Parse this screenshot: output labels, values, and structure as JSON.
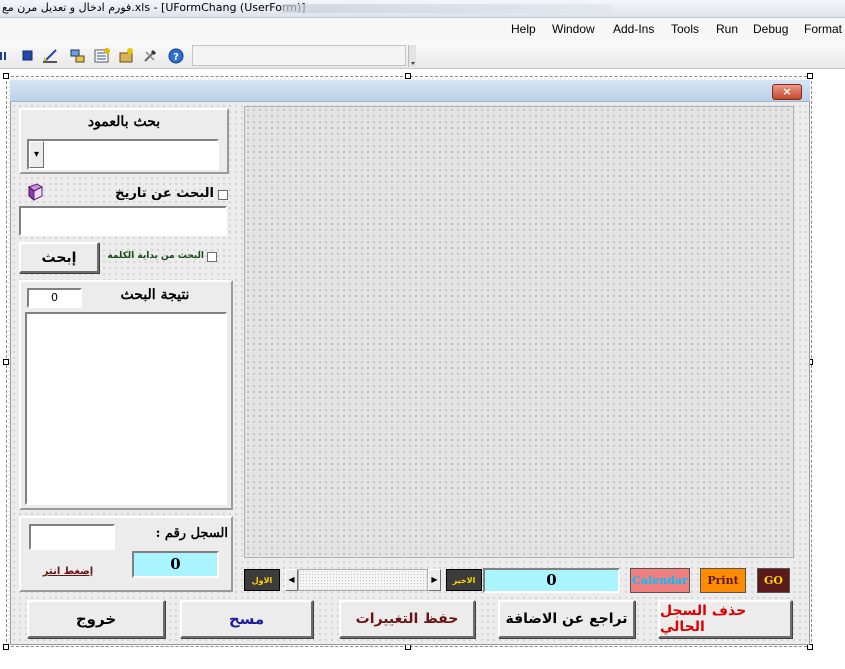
{
  "window": {
    "title": "فورم ادخال و تعديل مرن مع.xls - [UFormChang (UserForm)]"
  },
  "menu": [
    "Help",
    "Window",
    "Add-Ins",
    "Tools",
    "Run",
    "Debug",
    "Format"
  ],
  "form": {
    "close_glyph": "×",
    "column_search": {
      "label": "بحث بالعمود",
      "dropdown_glyph": "▾",
      "value": ""
    },
    "date_search": {
      "label": "البحث عن تاريخ",
      "checked": false,
      "value": ""
    },
    "word_start": {
      "label": "البحث من بداية الكلمة",
      "checked": false
    },
    "search_button": "إبحث",
    "results": {
      "label": "نتيجة البحث",
      "count": "0"
    },
    "record": {
      "label": "السجل رقم  :",
      "value": "",
      "number": "0",
      "enter_hint": "إضغط انتر"
    },
    "navigation": {
      "first": "الاول",
      "prev_glyph": "◀",
      "next_glyph": "▶",
      "last": "الاخير",
      "position": "0"
    },
    "buttons": {
      "calendar": "Calendar",
      "print": "Print",
      "go": "GO"
    },
    "actions": {
      "delete": "حذف السجل الحالي",
      "undo_add": "تراجع عن الاضافة",
      "save": "حفظ التغييرات",
      "clear": "مسح",
      "exit": "خروج"
    }
  },
  "colors": {
    "go_bg": "#5a1a1a",
    "go_fg": "#ffd700",
    "print_bg": "#ff8c00",
    "calendar_bg": "#f08080",
    "calendar_fg": "#00bfff",
    "cyan_field": "#aaf4ff",
    "delete_fg": "#e00000",
    "clear_fg": "#1c1c9c",
    "save_fg": "#6b1414"
  }
}
